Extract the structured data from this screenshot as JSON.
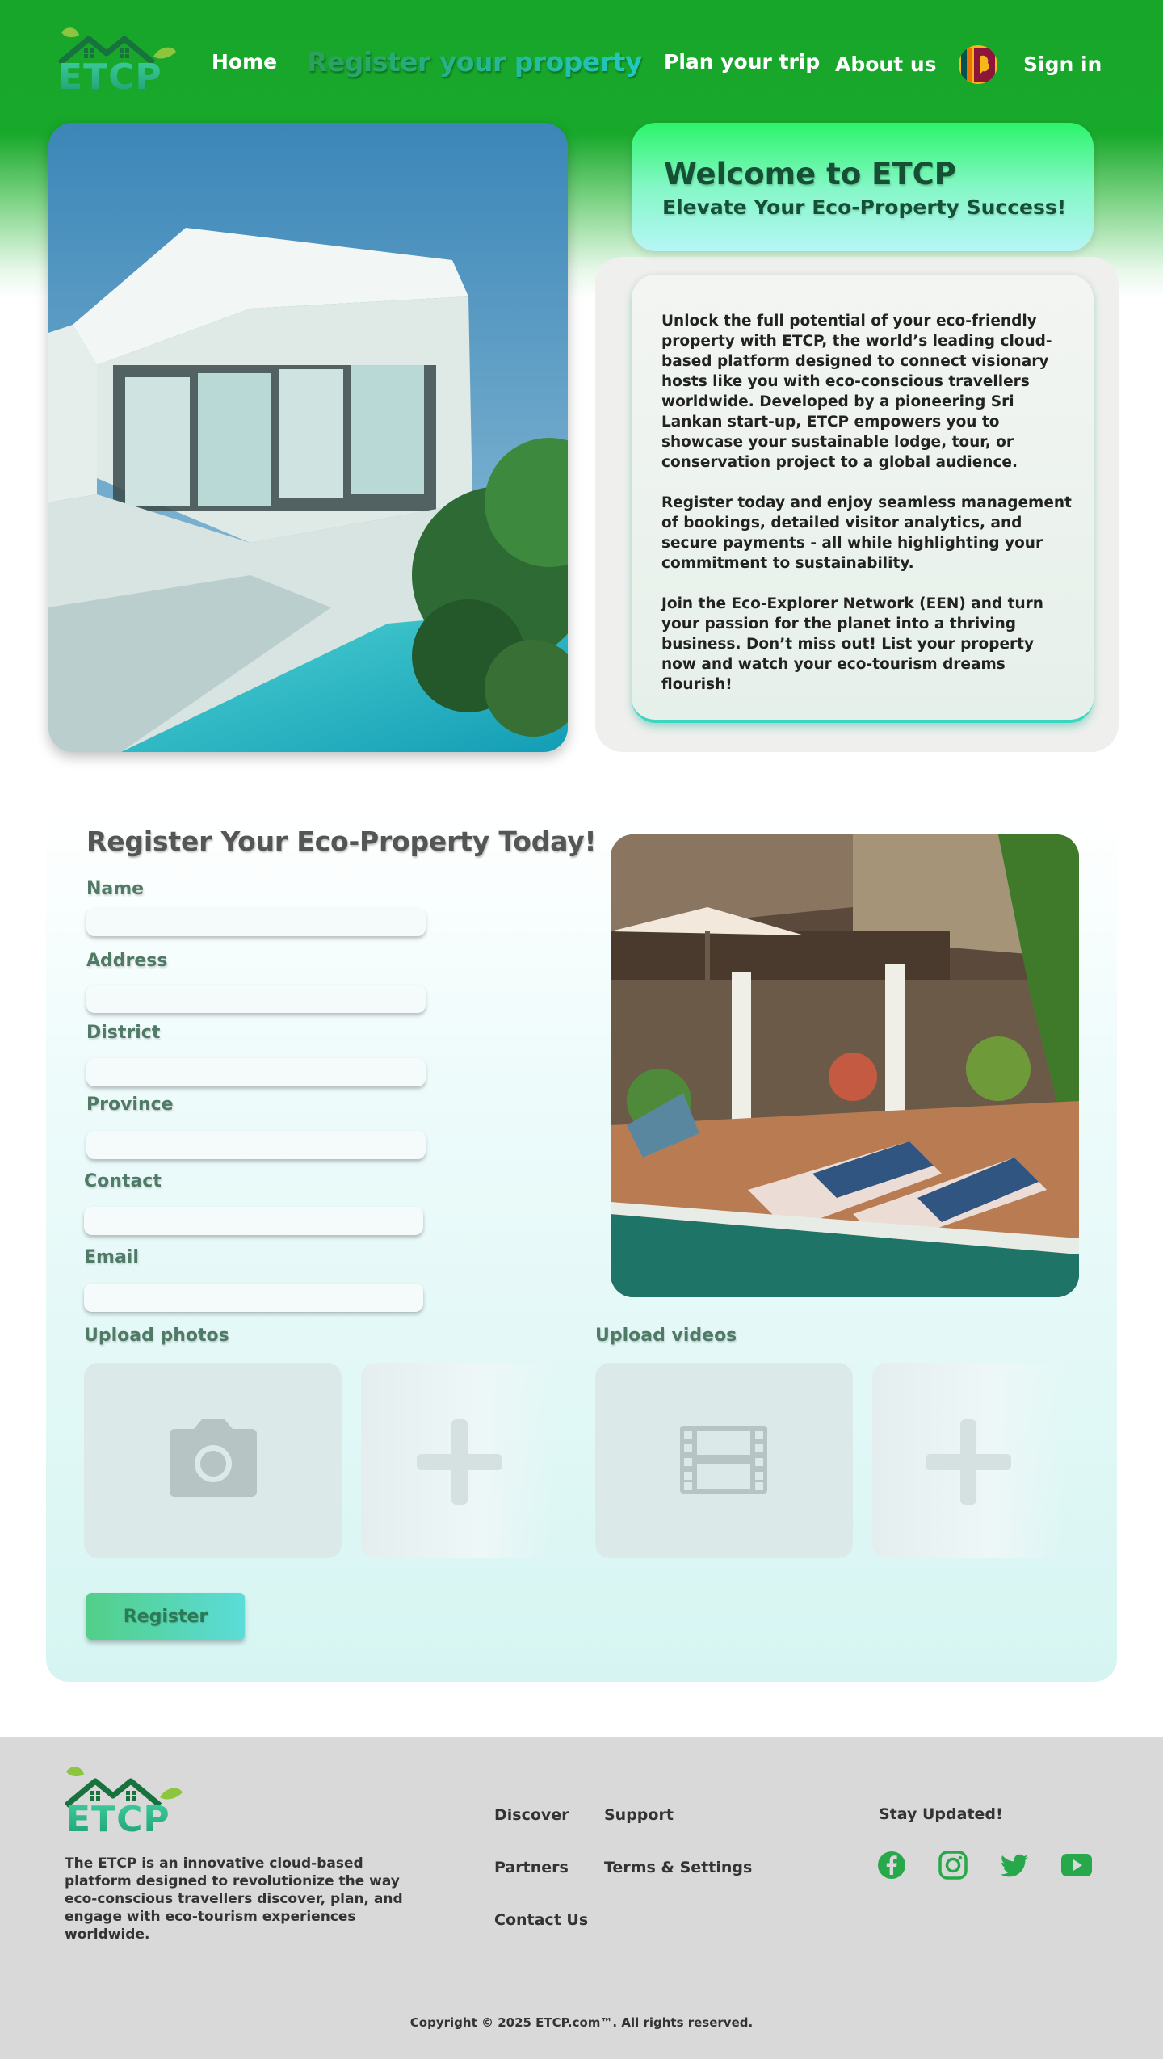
{
  "brand": {
    "logo_text": "ETCP",
    "primary_green": "#18a82b",
    "accent_teal": "#21c9c4"
  },
  "nav": {
    "home": "Home",
    "register": "Register your property",
    "plan": "Plan your trip",
    "about": "About us",
    "language_flag": "sri-lanka-flag-icon",
    "sign_in": "Sign in"
  },
  "welcome": {
    "title": "Welcome to ETCP",
    "subtitle": "Elevate Your Eco-Property Success!",
    "paragraphs": [
      "Unlock the full potential of your eco-friendly property with ETCP, the world’s leading cloud-based platform designed to connect visionary hosts like you with eco-conscious travellers worldwide. Developed by a pioneering Sri Lankan start-up, ETCP empowers you to showcase your sustainable lodge, tour, or conservation project to a global audience.",
      "Register today and enjoy seamless management of bookings, detailed visitor analytics, and secure payments - all while highlighting your commitment to sustainability.",
      "Join the Eco-Explorer Network (EEN) and turn your passion for the planet into a thriving business. Don’t miss out! List your property now and watch your eco-tourism dreams flourish!"
    ]
  },
  "form": {
    "title": "Register Your Eco-Property Today!",
    "fields": [
      {
        "label": "Name",
        "value": ""
      },
      {
        "label": "Address",
        "value": ""
      },
      {
        "label": "District",
        "value": ""
      },
      {
        "label": "Province",
        "value": ""
      },
      {
        "label": "Contact",
        "value": ""
      },
      {
        "label": "Email",
        "value": ""
      }
    ],
    "upload_photos": "Upload photos",
    "upload_videos": "Upload videos",
    "register_button": "Register"
  },
  "footer": {
    "logo_text": "ETCP",
    "description": "The ETCP is an innovative cloud-based platform designed to revolutionize the way eco-conscious travellers discover, plan, and engage with eco-tourism experiences worldwide.",
    "links": [
      "Discover",
      "Support",
      "Partners",
      "Terms & Settings",
      "Contact Us"
    ],
    "stay_updated": "Stay Updated!",
    "social": [
      "facebook-icon",
      "instagram-icon",
      "twitter-icon",
      "youtube-icon"
    ],
    "copyright": "Copyright © 2025 ETCP.com™. All rights reserved."
  }
}
